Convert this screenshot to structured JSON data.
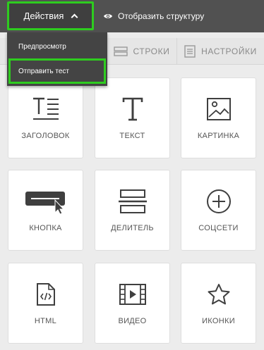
{
  "header": {
    "actions_label": "Действия",
    "structure_label": "Отобразить структуру"
  },
  "dropdown": {
    "items": [
      {
        "label": "Предпросмотр"
      },
      {
        "label": "Отправить тест"
      }
    ]
  },
  "tabs": [
    {
      "label": "СТРОКИ",
      "icon": "rows-icon"
    },
    {
      "label": "НАСТРОЙКИ",
      "icon": "settings-icon"
    }
  ],
  "blocks": [
    {
      "label": "ЗАГОЛОВОК",
      "icon": "heading-icon"
    },
    {
      "label": "ТЕКСТ",
      "icon": "text-icon"
    },
    {
      "label": "КАРТИНКА",
      "icon": "image-icon"
    },
    {
      "label": "КНОПКА",
      "icon": "button-icon"
    },
    {
      "label": "ДЕЛИТЕЛЬ",
      "icon": "divider-icon"
    },
    {
      "label": "СОЦСЕТИ",
      "icon": "social-plus-icon"
    },
    {
      "label": "HTML",
      "icon": "html-file-icon"
    },
    {
      "label": "ВИДЕО",
      "icon": "video-icon"
    },
    {
      "label": "ИКОНКИ",
      "icon": "star-icon"
    }
  ],
  "colors": {
    "topbar": "#515151",
    "highlight": "#2ecc1f",
    "dropdown": "#444444",
    "card_bg": "#ffffff",
    "page_bg": "#ececec"
  }
}
